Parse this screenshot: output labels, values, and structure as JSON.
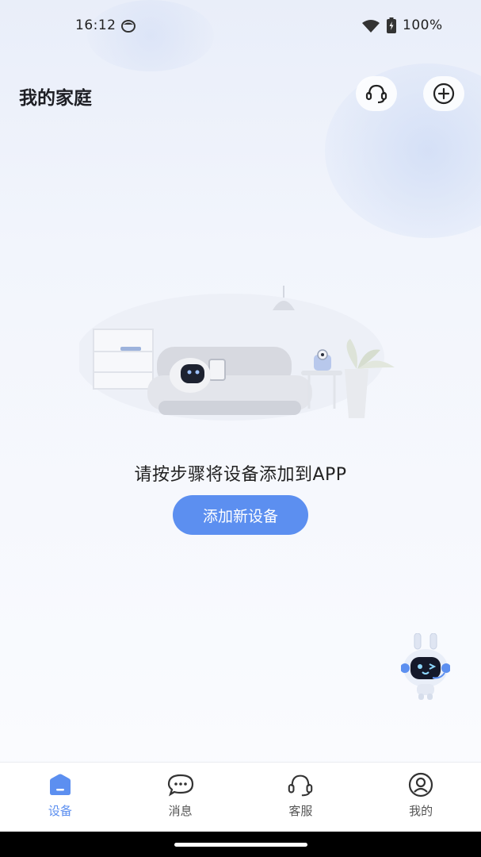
{
  "status_bar": {
    "time": "16:12",
    "battery": "100%"
  },
  "header": {
    "title": "我的家庭",
    "support_icon": "headset-icon",
    "add_icon": "plus-circle-icon"
  },
  "empty_state": {
    "message": "请按步骤将设备添加到APP",
    "button_label": "添加新设备"
  },
  "nav": {
    "items": [
      {
        "label": "设备",
        "icon": "home-icon",
        "active": true
      },
      {
        "label": "消息",
        "icon": "message-icon",
        "active": false
      },
      {
        "label": "客服",
        "icon": "headset-icon",
        "active": false
      },
      {
        "label": "我的",
        "icon": "profile-icon",
        "active": false
      }
    ]
  },
  "colors": {
    "accent": "#5c8ff0",
    "background": "#f2f5fc",
    "text": "#1e1f24"
  }
}
